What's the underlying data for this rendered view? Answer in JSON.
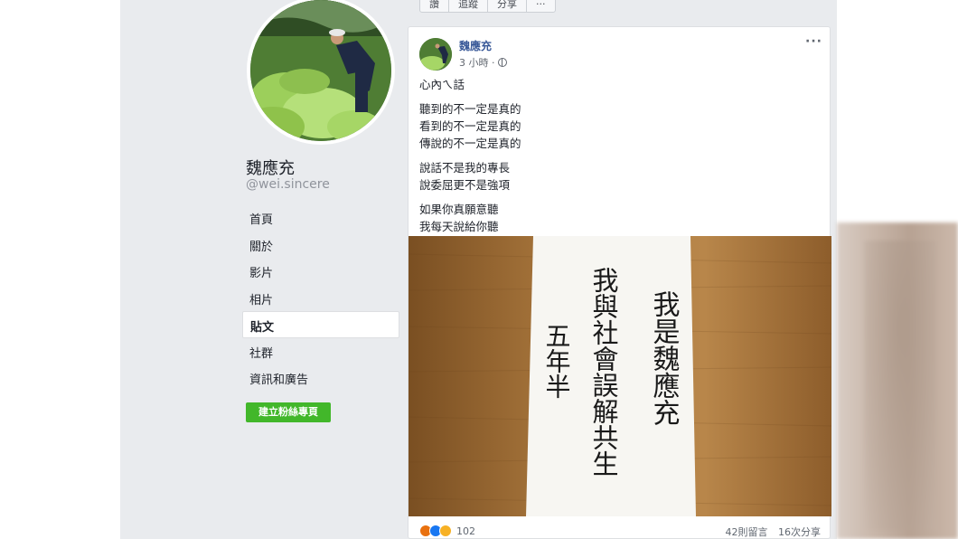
{
  "top_bar": {
    "items": [
      "讚",
      "追蹤",
      "分享",
      "···"
    ]
  },
  "profile": {
    "name": "魏應充",
    "handle": "@wei.sincere"
  },
  "nav": {
    "items": [
      "首頁",
      "關於",
      "影片",
      "相片",
      "貼文",
      "社群",
      "資訊和廣告"
    ],
    "active": "貼文"
  },
  "create_page_button": "建立粉絲專頁",
  "post": {
    "author": "魏應充",
    "time": "3 小時 ·",
    "menu_icon": "more-icon",
    "paragraphs": [
      [
        "心內ㄟ話"
      ],
      [
        "聽到的不一定是真的",
        "看到的不一定是真的",
        "傳說的不一定是真的"
      ],
      [
        "說話不是我的專長",
        "說委屈更不是強項"
      ],
      [
        "如果你真願意聽",
        "我每天說給你聽"
      ]
    ],
    "photo_calligraphy": {
      "col1": "我是魏應充",
      "col2": "我與社會誤解共生",
      "col3": "五年半"
    },
    "reaction_count": "102",
    "comments": "42則留言",
    "shares": "16次分享"
  },
  "colors": {
    "link_blue": "#385898",
    "page_bg": "#e9ebee",
    "green_button": "#42b72a",
    "wood": "#a8763c"
  }
}
